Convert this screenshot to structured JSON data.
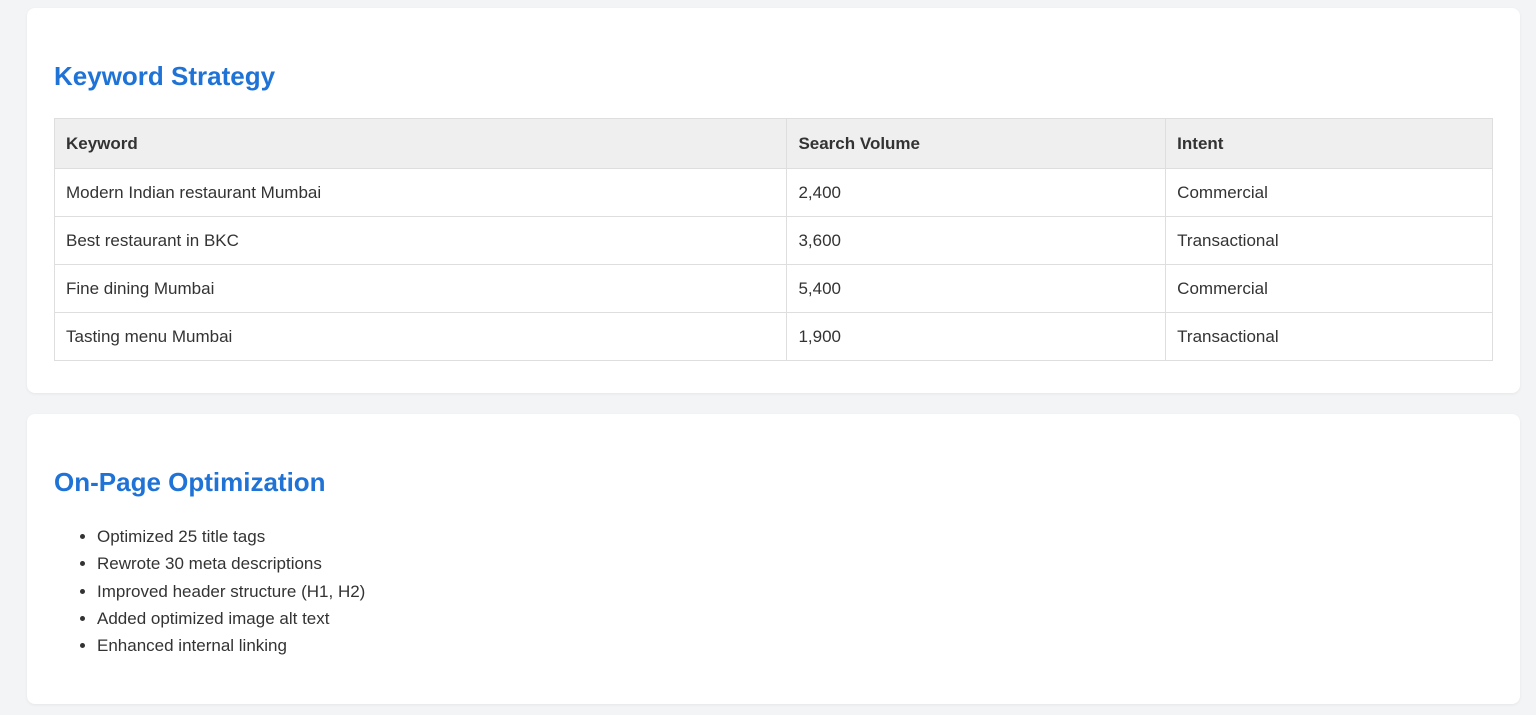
{
  "keyword_strategy": {
    "title": "Keyword Strategy",
    "columns": [
      "Keyword",
      "Search Volume",
      "Intent"
    ],
    "rows": [
      [
        "Modern Indian restaurant Mumbai",
        "2,400",
        "Commercial"
      ],
      [
        "Best restaurant in BKC",
        "3,600",
        "Transactional"
      ],
      [
        "Fine dining Mumbai",
        "5,400",
        "Commercial"
      ],
      [
        "Tasting menu Mumbai",
        "1,900",
        "Transactional"
      ]
    ]
  },
  "onpage": {
    "title": "On-Page Optimization",
    "items": [
      "Optimized 25 title tags",
      "Rewrote 30 meta descriptions",
      "Improved header structure (H1, H2)",
      "Added optimized image alt text",
      "Enhanced internal linking"
    ]
  },
  "colors": {
    "heading": "#1f73d6",
    "background": "#f3f4f6",
    "card": "#ffffff",
    "table_header": "#efefef"
  }
}
